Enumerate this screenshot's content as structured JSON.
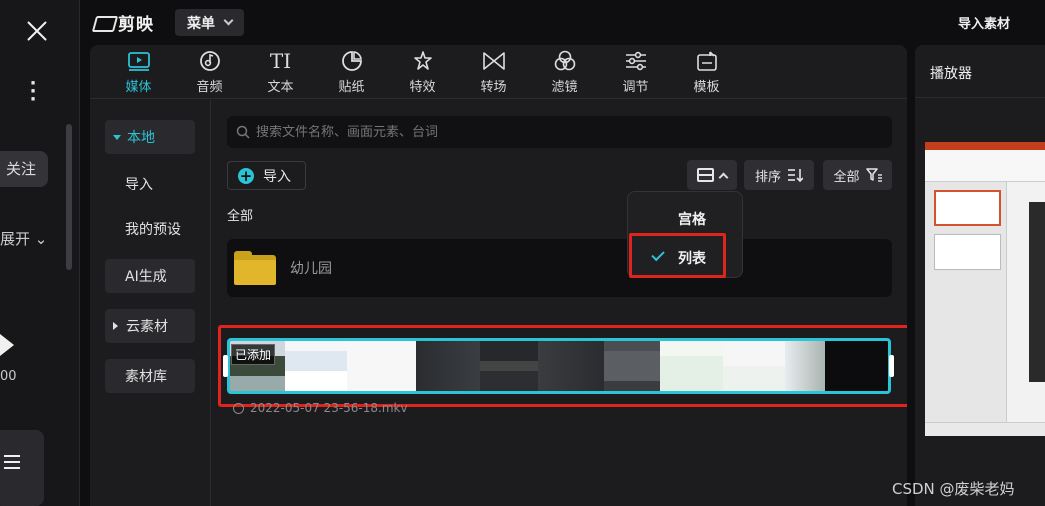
{
  "app": {
    "logo_text": "剪映",
    "menu_label": "菜单",
    "import_material": "导入素材"
  },
  "left_strip": {
    "follow": "关注",
    "expand": "展开",
    "count": "00"
  },
  "tabs": [
    {
      "label": "媒体",
      "icon": "media-icon"
    },
    {
      "label": "音频",
      "icon": "audio-icon"
    },
    {
      "label": "文本",
      "icon": "text-icon"
    },
    {
      "label": "贴纸",
      "icon": "sticker-icon"
    },
    {
      "label": "特效",
      "icon": "effects-icon"
    },
    {
      "label": "转场",
      "icon": "transition-icon"
    },
    {
      "label": "滤镜",
      "icon": "filter-icon"
    },
    {
      "label": "调节",
      "icon": "adjust-icon"
    },
    {
      "label": "模板",
      "icon": "template-icon"
    }
  ],
  "sidebar": {
    "items": [
      {
        "label": "本地"
      },
      {
        "label": "导入"
      },
      {
        "label": "我的预设"
      },
      {
        "label": "AI生成"
      },
      {
        "label": "云素材"
      },
      {
        "label": "素材库"
      }
    ]
  },
  "search": {
    "placeholder": "搜索文件名称、画面元素、台词"
  },
  "toolbar": {
    "import_label": "导入",
    "sort_label": "排序",
    "filter_label": "全部"
  },
  "section": {
    "all_label": "全部"
  },
  "folder": {
    "name": "幼儿园"
  },
  "view_menu": {
    "options": [
      {
        "label": "宫格",
        "selected": false
      },
      {
        "label": "列表",
        "selected": true
      }
    ]
  },
  "clip": {
    "badge": "已添加",
    "name": "2022-05-07 23-56-18.mkv"
  },
  "player": {
    "title": "播放器"
  },
  "watermark": "CSDN @废柴老妈",
  "colors": {
    "accent": "#2bc3d6",
    "highlight_red": "#e0231d",
    "folder_yellow": "#e2b62a"
  }
}
